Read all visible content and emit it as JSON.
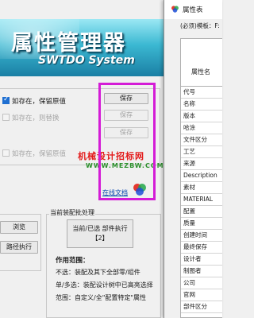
{
  "main": {
    "banner": {
      "title_cn": "属性管理器",
      "title_en": "SWTDO System"
    },
    "options": [
      {
        "label": "如存在，保留原值",
        "checked": true,
        "enabled": true,
        "button": "保存"
      },
      {
        "label": "如存在，则替换",
        "checked": false,
        "enabled": false,
        "button": "保存"
      },
      {
        "label": "如存在，保留原值",
        "checked": false,
        "enabled": false,
        "button": "保存"
      }
    ],
    "watermark": {
      "line1": "机械设计招标网",
      "line2": "WWW.MEZBW.COM"
    },
    "docs_link": "在线文档",
    "left_buttons": {
      "browse": "浏览",
      "path_exec": "路径执行"
    },
    "current_assembly": {
      "group_title": "当前装配批处理",
      "button_line1": "当前/已选 部件执行",
      "button_line2": "【2】",
      "scope_title": "作用范围：",
      "scope_lines": [
        "不选：装配及其下全部零/组件",
        "单/多选：装配设计树中已高亮选择",
        "范围：自定义/全\"配置特定\"属性"
      ]
    }
  },
  "props_window": {
    "title": "属性表",
    "template_label": "(必须)模板：F:",
    "header": "属性名",
    "rows": [
      "代号",
      "名称",
      "版本",
      "哈涂",
      "文件区分",
      "工艺",
      "来源",
      "Description",
      "素材",
      "MATERIAL",
      "配置",
      "质量",
      "创建时间",
      "最终保存",
      "设计者",
      "制图者",
      "公司",
      "官网",
      "部件区分"
    ]
  },
  "colors": {
    "highlight_box": "#d41cd6",
    "watermark_red": "#e31b1b",
    "watermark_green": "#2a8f2a",
    "link": "#0645ad"
  }
}
